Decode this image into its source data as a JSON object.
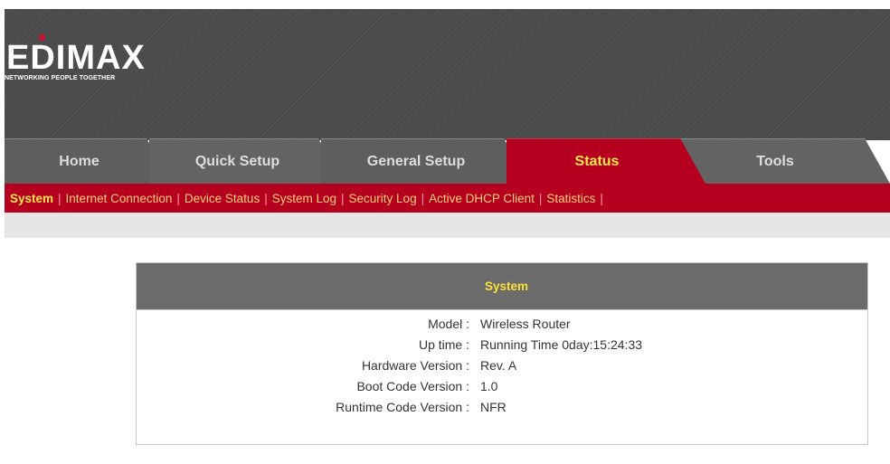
{
  "brand": {
    "name": "EDIMAX",
    "tagline": "NETWORKING PEOPLE TOGETHER"
  },
  "tabs": [
    {
      "label": "Home"
    },
    {
      "label": "Quick Setup"
    },
    {
      "label": "General Setup"
    },
    {
      "label": "Status"
    },
    {
      "label": "Tools"
    }
  ],
  "submenu": [
    {
      "label": "System"
    },
    {
      "label": "Internet Connection"
    },
    {
      "label": "Device Status"
    },
    {
      "label": "System Log"
    },
    {
      "label": "Security Log"
    },
    {
      "label": "Active DHCP Client"
    },
    {
      "label": "Statistics"
    }
  ],
  "separator": "|",
  "panel": {
    "title": "System",
    "rows": [
      {
        "label": "Model :",
        "value": "Wireless Router"
      },
      {
        "label": "Up time :",
        "value": "Running Time 0day:15:24:33"
      },
      {
        "label": "Hardware Version :",
        "value": "Rev. A"
      },
      {
        "label": "Boot Code Version :",
        "value": "1.0"
      },
      {
        "label": "Runtime Code Version :",
        "value": "NFR"
      }
    ]
  },
  "colors": {
    "header_bg": "#4a4a4a",
    "accent_red": "#b5001f",
    "active_text": "#ffe84a",
    "panel_head_bg": "#6b6b6b"
  }
}
